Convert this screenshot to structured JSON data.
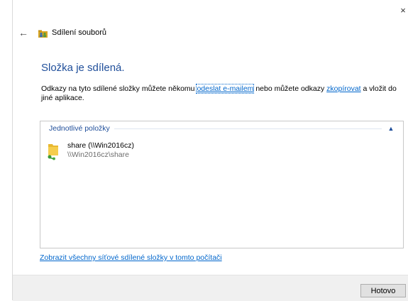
{
  "window": {
    "close_glyph": "×",
    "back_glyph": "←",
    "title": "Sdílení souborů"
  },
  "main": {
    "heading": "Složka je sdílená.",
    "desc_part1": "Odkazy na tyto sdílené složky můžete někomu ",
    "link_email": "odeslat e-mailem",
    "desc_part2": " nebo můžete odkazy ",
    "link_copy": "zkopírovat",
    "desc_part3": " a vložit do jiné aplikace."
  },
  "items_group": {
    "label": "Jednotlivé položky",
    "collapse_glyph": "▲",
    "items": [
      {
        "name": "share (\\\\Win2016cz)",
        "path": "\\\\Win2016cz\\share",
        "icon": "shared-folder-icon"
      }
    ]
  },
  "show_all_link": "Zobrazit všechny síťové sdílené složky v tomto počítači",
  "footer": {
    "done_label": "Hotovo"
  },
  "colors": {
    "heading": "#1f4e9a",
    "link": "#0066cc",
    "footer_bg": "#f0f0f0"
  }
}
